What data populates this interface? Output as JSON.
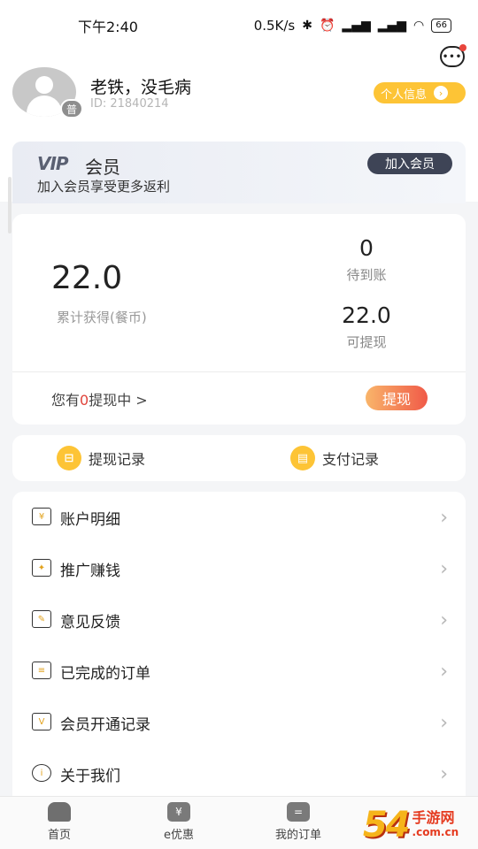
{
  "status_bar": {
    "time": "下午2:40",
    "net_speed": "0.5K/s",
    "battery": "66"
  },
  "profile": {
    "name": "老铁，没毛病",
    "id": "ID: 21840214",
    "badge": "普",
    "info_button": "个人信息"
  },
  "vip": {
    "logo": "VIP",
    "title": "会员",
    "subtitle": "加入会员享受更多返利",
    "join_button": "加入会员"
  },
  "earnings": {
    "total": "22.0",
    "total_label": "累计获得(餐币)",
    "pending_value": "0",
    "pending_label": "待到账",
    "withdrawable_value": "22.0",
    "withdrawable_label": "可提现",
    "withdrawing_prefix": "您有",
    "withdrawing_count": "0",
    "withdrawing_suffix": "提现中 >",
    "withdraw_button": "提现"
  },
  "records": {
    "withdraw_records": "提现记录",
    "payment_records": "支付记录"
  },
  "menu": [
    {
      "label": "账户明细",
      "icon": "ledger-icon"
    },
    {
      "label": "推广赚钱",
      "icon": "gift-icon"
    },
    {
      "label": "意见反馈",
      "icon": "edit-icon"
    },
    {
      "label": "已完成的订单",
      "icon": "order-list-icon"
    },
    {
      "label": "会员开通记录",
      "icon": "vip-folder-icon"
    },
    {
      "label": "关于我们",
      "icon": "info-icon"
    }
  ],
  "tabs": [
    {
      "label": "首页"
    },
    {
      "label": "e优惠"
    },
    {
      "label": "我的订单"
    }
  ],
  "watermark": {
    "num": "54",
    "name": "手游网",
    "url": ".com.cn"
  }
}
